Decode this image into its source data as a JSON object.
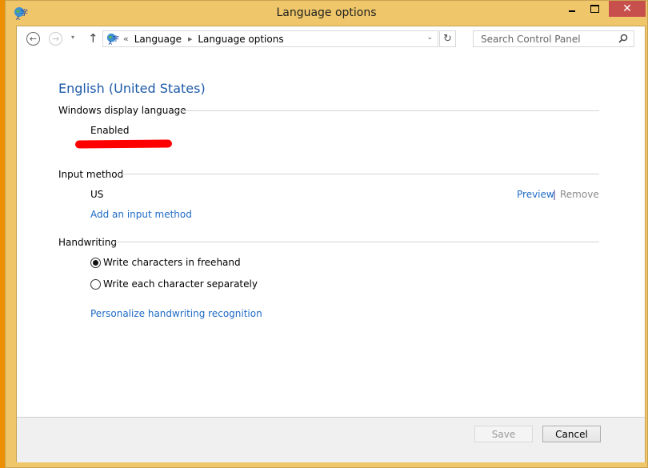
{
  "window": {
    "title": "Language options",
    "icon": "language-globe-icon",
    "controls": {
      "minimize": "minimize-icon",
      "maximize": "maximize-icon",
      "close": "✕"
    }
  },
  "navigation": {
    "back_icon": "←",
    "forward_icon": "→",
    "recent_icon": "▾",
    "up_icon": "↑",
    "breadcrumb_overflow": "«",
    "breadcrumb": [
      "Language",
      "Language options"
    ],
    "breadcrumb_separator": "▶",
    "address_dropdown_icon": "⌄",
    "refresh_icon": "↻",
    "search": {
      "placeholder": "Search Control Panel",
      "value": ""
    }
  },
  "content": {
    "heading": "English (United States)",
    "sections": {
      "display_language": {
        "label": "Windows display language",
        "status": "Enabled"
      },
      "input_method": {
        "label": "Input method",
        "method": "US",
        "preview_link": "Preview",
        "separator": "|",
        "remove_link": "Remove",
        "add_link": "Add an input method"
      },
      "handwriting": {
        "label": "Handwriting",
        "options": [
          {
            "label": "Write characters in freehand",
            "selected": true
          },
          {
            "label": "Write each character separately",
            "selected": false
          }
        ],
        "personalize_link": "Personalize handwriting recognition"
      }
    }
  },
  "footer": {
    "save_label": "Save",
    "save_enabled": false,
    "cancel_label": "Cancel"
  },
  "colors": {
    "frame": "#efc76a",
    "link": "#1e6ac5",
    "heading": "#1e5aa8",
    "close_button": "#c7504c",
    "redaction": "#ff0000"
  }
}
